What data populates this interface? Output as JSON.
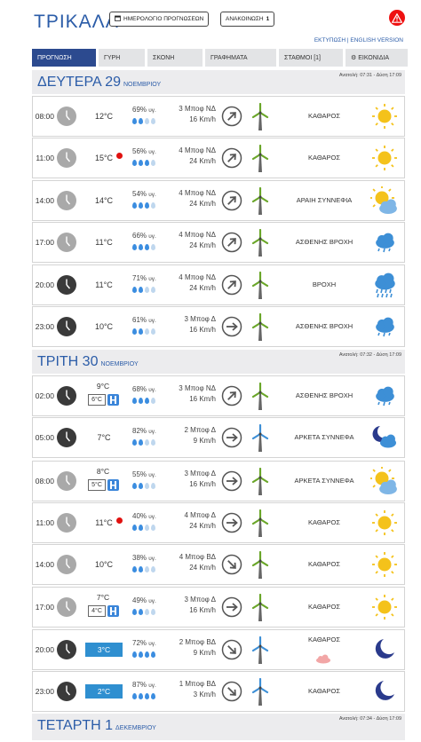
{
  "header": {
    "city": "ΤΡΙΚΑΛΑ",
    "calendar_label": "ΗΜΕΡΟΛΟΓΙΟ ΠΡΟΓΝΩΣΕΩΝ",
    "announcement_label": "ΑΝΑΚΟΙΝΩΣΗ",
    "announcement_count": "1",
    "print_label": "ΕΚΤΥΠΩΣΗ",
    "separator": "|",
    "english_label": "ENGLISH VERSION"
  },
  "tabs": [
    {
      "label": "ΠΡΟΓΝΩΣΗ",
      "active": true
    },
    {
      "label": "ΓΥΡΗ",
      "active": false
    },
    {
      "label": "ΣΚΟΝΗ",
      "active": false
    },
    {
      "label": "ΓΡΑΦΗΜΑΤΑ",
      "active": false
    },
    {
      "label": "ΣΤΑΘΜΟΙ [1]",
      "active": false
    },
    {
      "label": "⚙ ΕΙΚΟΝΙΔΙΑ",
      "active": false
    }
  ],
  "days": [
    {
      "name": "ΔΕΥΤΕΡΑ 29",
      "month": "ΝΟΕΜΒΡΙΟΥ",
      "sun": "Ανατολή: 07:31 - Δύση 17:09"
    },
    {
      "name": "ΤΡΙΤΗ 30",
      "month": "ΝΟΕΜΒΡΙΟΥ",
      "sun": "Ανατολή: 07:32 - Δύση 17:09"
    },
    {
      "name": "ΤΕΤΑΡΤΗ 1",
      "month": "ΔΕΚΕΜΒΡΙΟΥ",
      "sun": "Ανατολή: 07:34 - Δύση 17:09"
    }
  ],
  "humidity_unit": "υγ.",
  "rows": [
    {
      "time": "08:00",
      "night": false,
      "temp": "12°C",
      "dot": false,
      "hum": "69%",
      "drops": 2,
      "wind1": "3 Μποφ ΝΔ",
      "wind2": "16 Km/h",
      "dir": "ne",
      "turbine": "green",
      "desc": "ΚΑΘΑΡΟΣ",
      "icon": "sun"
    },
    {
      "time": "11:00",
      "night": false,
      "temp": "15°C",
      "dot": true,
      "hum": "56%",
      "drops": 3,
      "wind1": "4 Μποφ ΝΔ",
      "wind2": "24 Km/h",
      "dir": "ne",
      "turbine": "green",
      "desc": "ΚΑΘΑΡΟΣ",
      "icon": "sun"
    },
    {
      "time": "14:00",
      "night": false,
      "temp": "14°C",
      "dot": false,
      "hum": "54%",
      "drops": 3,
      "wind1": "4 Μποφ ΝΔ",
      "wind2": "24 Km/h",
      "dir": "ne",
      "turbine": "green",
      "desc": "ΑΡΑΙΗ ΣΥΝΝΕΦΙΑ",
      "icon": "suncloud"
    },
    {
      "time": "17:00",
      "night": false,
      "temp": "11°C",
      "dot": false,
      "hum": "66%",
      "drops": 3,
      "wind1": "4 Μποφ ΝΔ",
      "wind2": "24 Km/h",
      "dir": "ne",
      "turbine": "green",
      "desc": "ΑΣΘΕΝΗΣ ΒΡΟΧΗ",
      "icon": "rain"
    },
    {
      "time": "20:00",
      "night": true,
      "temp": "11°C",
      "dot": false,
      "hum": "71%",
      "drops": 2,
      "wind1": "4 Μποφ ΝΔ",
      "wind2": "24 Km/h",
      "dir": "ne",
      "turbine": "green",
      "desc": "ΒΡΟΧΗ",
      "icon": "heavyrain"
    },
    {
      "time": "23:00",
      "night": true,
      "temp": "10°C",
      "dot": false,
      "hum": "61%",
      "drops": 2,
      "wind1": "3 Μποφ Δ",
      "wind2": "16 Km/h",
      "dir": "e",
      "turbine": "green",
      "desc": "ΑΣΘΕΝΗΣ ΒΡΟΧΗ",
      "icon": "rain"
    },
    {
      "time": "02:00",
      "night": true,
      "tmax": "9°C",
      "tmin": "6°C",
      "hum": "68%",
      "drops": 3,
      "wind1": "3 Μποφ ΝΔ",
      "wind2": "16 Km/h",
      "dir": "ne",
      "turbine": "green",
      "desc": "ΑΣΘΕΝΗΣ ΒΡΟΧΗ",
      "icon": "rain"
    },
    {
      "time": "05:00",
      "night": true,
      "temp": "7°C",
      "dot": false,
      "hum": "82%",
      "drops": 2,
      "wind1": "2 Μποφ Δ",
      "wind2": "9 Km/h",
      "dir": "e",
      "turbine": "blue",
      "desc": "ΑΡΚΕΤΑ ΣΥΝΝΕΦΑ",
      "icon": "mooncloud"
    },
    {
      "time": "08:00",
      "night": false,
      "tmax": "8°C",
      "tmin": "5°C",
      "hum": "55%",
      "drops": 2,
      "wind1": "3 Μποφ Δ",
      "wind2": "16 Km/h",
      "dir": "e",
      "turbine": "green",
      "desc": "ΑΡΚΕΤΑ ΣΥΝΝΕΦΑ",
      "icon": "suncloud"
    },
    {
      "time": "11:00",
      "night": false,
      "temp": "11°C",
      "dot": true,
      "hum": "40%",
      "drops": 2,
      "wind1": "4 Μποφ Δ",
      "wind2": "24 Km/h",
      "dir": "e",
      "turbine": "green",
      "desc": "ΚΑΘΑΡΟΣ",
      "icon": "sun"
    },
    {
      "time": "14:00",
      "night": false,
      "temp": "10°C",
      "dot": false,
      "hum": "38%",
      "drops": 2,
      "wind1": "4 Μποφ ΒΔ",
      "wind2": "24 Km/h",
      "dir": "se",
      "turbine": "green",
      "desc": "ΚΑΘΑΡΟΣ",
      "icon": "sun"
    },
    {
      "time": "17:00",
      "night": false,
      "tmax": "7°C",
      "tmin": "4°C",
      "hum": "49%",
      "drops": 2,
      "wind1": "3 Μποφ Δ",
      "wind2": "16 Km/h",
      "dir": "e",
      "turbine": "green",
      "desc": "ΚΑΘΑΡΟΣ",
      "icon": "sun"
    },
    {
      "time": "20:00",
      "night": true,
      "blue": "3°C",
      "hum": "72%",
      "drops": 4,
      "wind1": "2 Μποφ ΒΔ",
      "wind2": "9 Km/h",
      "dir": "se",
      "turbine": "blue",
      "desc": "ΚΑΘΑΡΟΣ",
      "smallcloud": true,
      "icon": "moon"
    },
    {
      "time": "23:00",
      "night": true,
      "blue": "2°C",
      "hum": "87%",
      "drops": 4,
      "wind1": "1 Μποφ ΒΔ",
      "wind2": "3 Km/h",
      "dir": "se",
      "turbine": "blue",
      "desc": "ΚΑΘΑΡΟΣ",
      "icon": "moon"
    }
  ],
  "colors": {
    "accent": "#2b5ca8",
    "tab_active": "#2c4a8f",
    "rain": "#3b8de0",
    "sun": "#f4c21b",
    "alert": "#e11"
  }
}
